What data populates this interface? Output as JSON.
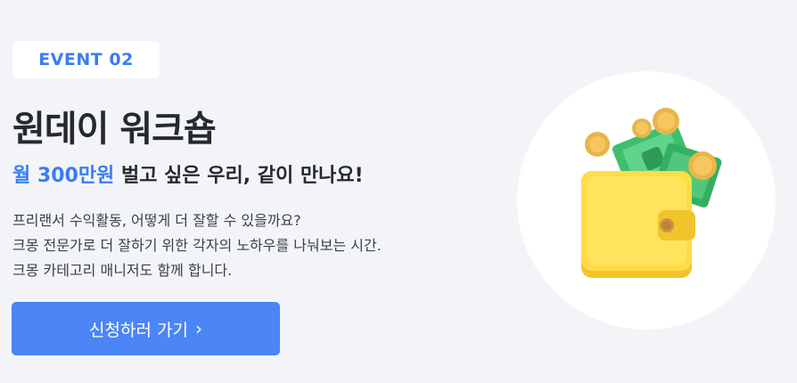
{
  "event": {
    "badge": "EVENT 02"
  },
  "headline": {
    "title": "원데이 워크숍",
    "subtitle_highlight": "월 300만원",
    "subtitle_rest": " 벌고 싶은 우리, 같이 만나요!"
  },
  "description": {
    "lines": [
      "프리랜서 수익활동, 어떻게 더 잘할 수 있을까요?",
      "크몽 전문가로 더 잘하기 위한 각자의 노하우를 나눠보는 시간.",
      "크몽 카테고리 매니저도 함께 합니다."
    ]
  },
  "cta": {
    "label": "신청하러 가기",
    "icon": "chevron-right-icon"
  },
  "illustration": {
    "icon": "wallet-money-icon"
  },
  "colors": {
    "accent": "#3b7cf4",
    "button": "#4b85f6",
    "background": "#f2f4f7"
  }
}
